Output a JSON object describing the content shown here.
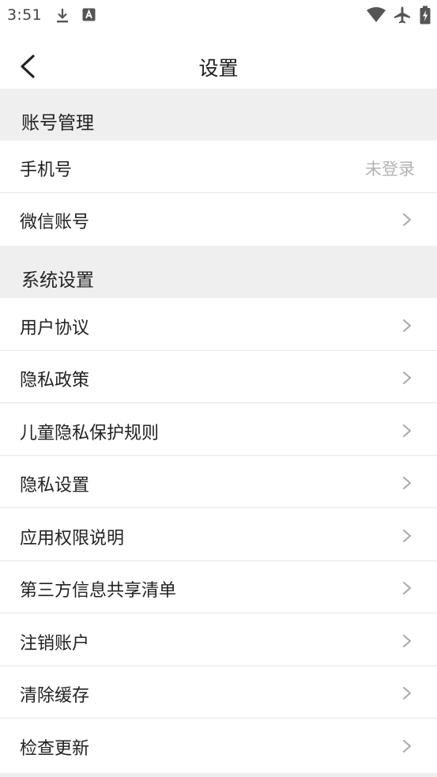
{
  "status_bar": {
    "time": "3:51",
    "icons": [
      "download-icon",
      "a-icon",
      "wifi-icon",
      "airplane-icon",
      "battery-charging-icon"
    ]
  },
  "header": {
    "title": "设置",
    "back_icon": "chevron-left-icon"
  },
  "sections": {
    "account": {
      "title": "账号管理",
      "items": [
        {
          "label": "手机号",
          "value": "未登录"
        },
        {
          "label": "微信账号"
        }
      ]
    },
    "system": {
      "title": "系统设置",
      "items": [
        {
          "label": "用户协议"
        },
        {
          "label": "隐私政策"
        },
        {
          "label": "儿童隐私保护规则"
        },
        {
          "label": "隐私设置"
        },
        {
          "label": "应用权限说明"
        },
        {
          "label": "第三方信息共享清单"
        },
        {
          "label": "注销账户"
        },
        {
          "label": "清除缓存"
        },
        {
          "label": "检查更新"
        }
      ]
    }
  },
  "colors": {
    "section_bg": "#efefef",
    "divider": "#e6e6e6",
    "secondary_text": "#b3b3b3",
    "chevron": "#a8a8a8"
  }
}
